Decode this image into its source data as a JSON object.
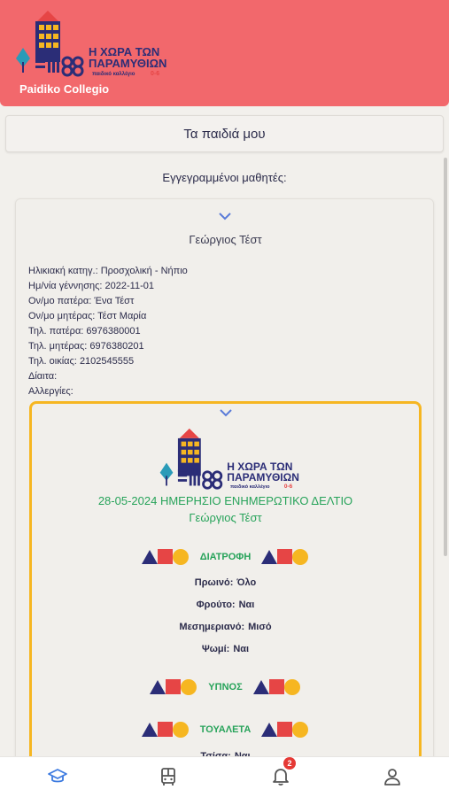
{
  "header": {
    "logo": {
      "title_line1": "Η ΧΩΡΑ ΤΩΝ",
      "title_line2": "ΠΑΡΑΜΥΘΙΩΝ",
      "subtitle": "παιδικό καλλέγιο",
      "age": "0-6"
    },
    "brand": "Paidiko Collegio",
    "color": "#f2686c"
  },
  "title": "Τα παιδιά μου",
  "enrolled_label": "Εγγεγραμμένοι μαθητές:",
  "child": {
    "name": "Γεώργιος  Τέστ",
    "info": [
      {
        "label": "Ηλικιακή κατηγ.:",
        "value": "Προσχολική - Νήπιο"
      },
      {
        "label": "Ημ/νία γέννησης:",
        "value": "2022-11-01"
      },
      {
        "label": "Ον/μο πατέρα:",
        "value": "Ένα Τέστ"
      },
      {
        "label": "Ον/μο μητέρας:",
        "value": "Τέστ Μαρία"
      },
      {
        "label": "Τηλ. πατέρα:",
        "value": "6976380001"
      },
      {
        "label": "Τηλ. μητέρας:",
        "value": "6976380201"
      },
      {
        "label": "Τηλ. οικίας:",
        "value": "2102545555"
      },
      {
        "label": "Δίαιτα:",
        "value": ""
      },
      {
        "label": "Αλλεργίες:",
        "value": ""
      }
    ]
  },
  "report": {
    "date_title": "28-05-2024 ΗΜΕΡΗΣΙΟ ΕΝΗΜΕΡΩΤΙΚΟ ΔΕΛΤΙΟ",
    "name": "Γεώργιος Τέστ",
    "accent": "#f6b621",
    "sections": {
      "diet": "ΔΙΑΤΡΟΦΗ",
      "sleep": "ΥΠΝΟΣ",
      "toilet": "ΤΟΥΑΛΕΤΑ"
    },
    "diet_rows": [
      {
        "label": "Πρωινό:",
        "value": "Όλο"
      },
      {
        "label": "Φρούτο:",
        "value": "Ναι"
      },
      {
        "label": "Μεσημεριανό:",
        "value": "Μισό"
      },
      {
        "label": "Ψωμί:",
        "value": "Ναι"
      }
    ],
    "toilet_rows": [
      {
        "label": "Τσίσα:",
        "value": "Ναι"
      }
    ]
  },
  "bottom_nav": {
    "items": [
      {
        "icon": "graduation-cap-icon",
        "active": true
      },
      {
        "icon": "bus-icon",
        "active": false
      },
      {
        "icon": "bell-icon",
        "active": false
      },
      {
        "icon": "user-icon",
        "active": false
      }
    ],
    "notification_count": "2"
  }
}
